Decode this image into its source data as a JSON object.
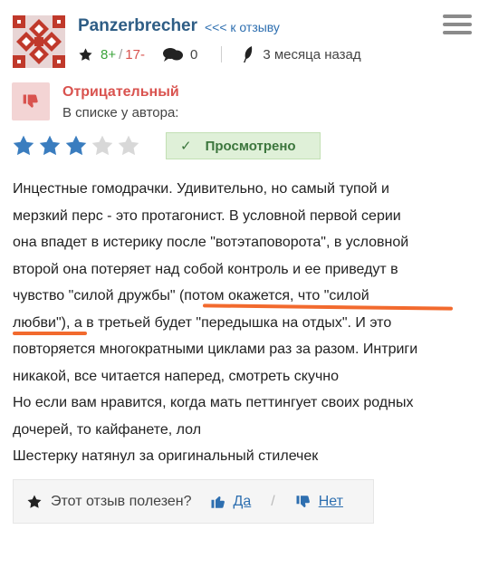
{
  "header": {
    "username": "Panzerbrecher",
    "back_link": "<<< к отзыву",
    "stats": {
      "plus": "8+",
      "minus": "17-",
      "comments": "0",
      "time": "3 месяца назад"
    }
  },
  "verdict": {
    "label": "Отрицательный",
    "list_text": "В списке у автора:"
  },
  "rating": {
    "value": 3,
    "max": 5
  },
  "status": {
    "label": "Просмотрено"
  },
  "review_lines": [
    "Инцестные гомодрачки. Удивительно, но самый тупой и",
    "мерзкий перс - это протагонист. В условной первой серии",
    "она впадет в истерику после \"вотэтаповорота\", в условной",
    "второй она потеряет над собой контроль и ее приведут в",
    "чувство \"силой дружбы\" (потом окажется, что \"силой",
    "любви\"), а в третьей будет \"передышка на отдых\". И это",
    "повторяется многократными циклами раз за разом. Интриги",
    "никакой, все читается наперед, смотреть скучно",
    "Но если вам нравится, когда мать петтингует своих родных",
    "дочерей, то кайфанете, лол",
    "Шестерку натянул за оригинальный стилечек"
  ],
  "helpful": {
    "question": "Этот отзыв полезен?",
    "yes": "Да",
    "no": "Нет"
  },
  "colors": {
    "accent": "#2e5d85",
    "negative": "#d9534f",
    "star": "#3a7dbf",
    "highlight": "#f26a2e"
  }
}
